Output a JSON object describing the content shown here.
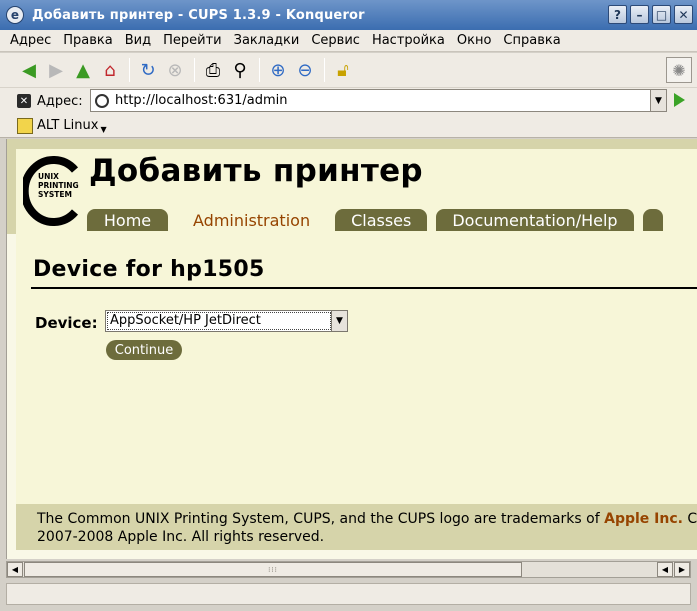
{
  "window": {
    "title": "Добавить принтер - CUPS 1.3.9 - Konqueror",
    "buttons": {
      "help": "?",
      "minimize": "–",
      "maximize": "□",
      "close": "✕"
    }
  },
  "menu": [
    "Адрес",
    "Правка",
    "Вид",
    "Перейти",
    "Закладки",
    "Сервис",
    "Настройка",
    "Окно",
    "Справка"
  ],
  "toolbar": {
    "icons": [
      "back-icon",
      "forward-icon",
      "up-icon",
      "home-icon",
      "reload-icon",
      "stop-icon",
      "print-icon",
      "find-icon",
      "zoom-in-icon",
      "zoom-out-icon",
      "security-icon"
    ]
  },
  "location": {
    "label": "Адрес:",
    "url": "http://localhost:631/admin"
  },
  "bookmarks": {
    "items": [
      "ALT Linux"
    ]
  },
  "page": {
    "heading": "Добавить принтер",
    "logo_text": [
      "UNIX",
      "PRINTING",
      "SYSTEM"
    ],
    "tabs": [
      "Home",
      "Administration",
      "Classes",
      "Documentation/Help"
    ],
    "active_tab": "Administration",
    "section_title": "Device for hp1505",
    "device_label": "Device:",
    "device_selected": "AppSocket/HP JetDirect",
    "continue_label": "Continue",
    "footer_text_1": "The Common UNIX Printing System, CUPS, and the CUPS logo are trademarks of ",
    "footer_link": "Apple Inc.",
    "footer_tail": " CU",
    "footer_text_2": "2007-2008 Apple Inc. All rights reserved."
  },
  "colors": {
    "tab_bg": "#6d6c3c",
    "active_tab_text": "#964400",
    "header_band": "#d6d4aa",
    "content_bg": "#f7f6d8"
  }
}
